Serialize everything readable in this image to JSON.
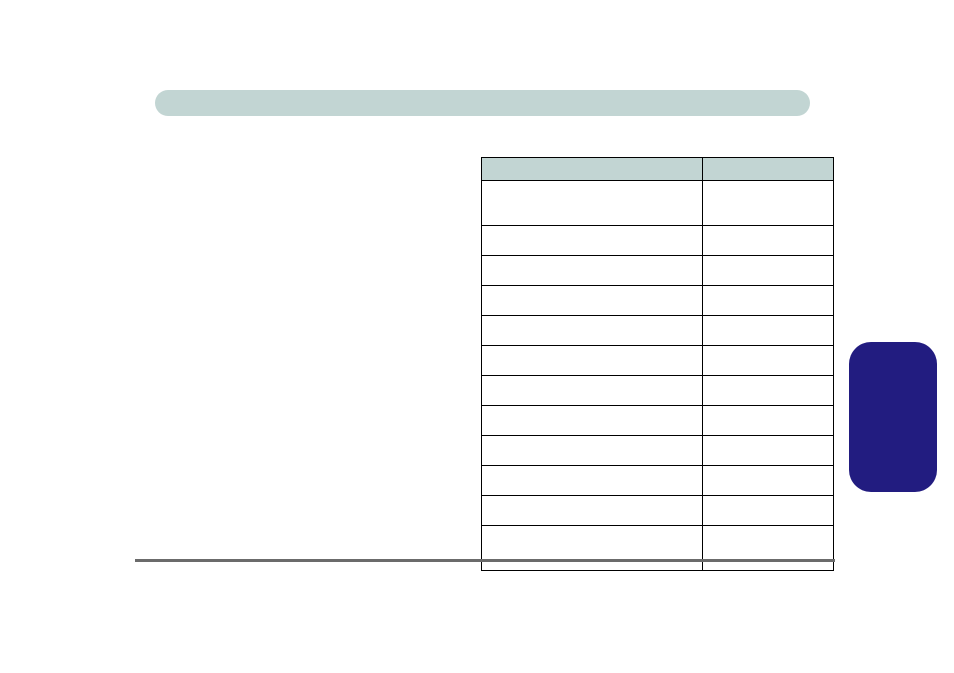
{
  "header_bar_label": "",
  "side_tab_label": "",
  "table": {
    "headers": [
      "",
      ""
    ],
    "rows": [
      {
        "cells": [
          "",
          ""
        ],
        "tall": true
      },
      {
        "cells": [
          "",
          ""
        ],
        "tall": false
      },
      {
        "cells": [
          "",
          ""
        ],
        "tall": false
      },
      {
        "cells": [
          "",
          ""
        ],
        "tall": false
      },
      {
        "cells": [
          "",
          ""
        ],
        "tall": false
      },
      {
        "cells": [
          "",
          ""
        ],
        "tall": false
      },
      {
        "cells": [
          "",
          ""
        ],
        "tall": false
      },
      {
        "cells": [
          "",
          ""
        ],
        "tall": false
      },
      {
        "cells": [
          "",
          ""
        ],
        "tall": false
      },
      {
        "cells": [
          "",
          ""
        ],
        "tall": false
      },
      {
        "cells": [
          "",
          ""
        ],
        "tall": false
      },
      {
        "cells": [
          "",
          ""
        ],
        "tall": true
      }
    ]
  }
}
